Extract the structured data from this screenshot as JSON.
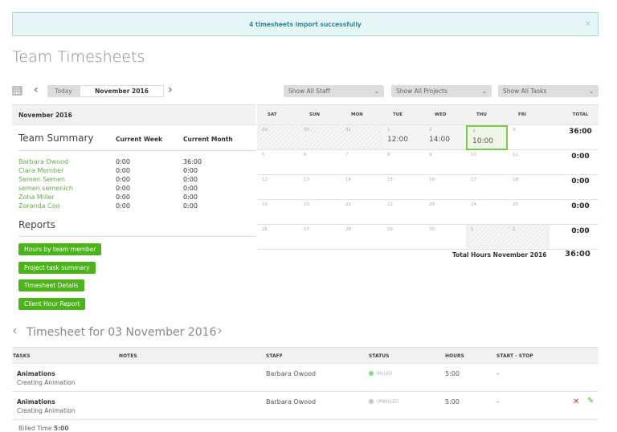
{
  "banner": {
    "message": "4 timesheets import successfully",
    "close": "×"
  },
  "page_title": "Team Timesheets",
  "toolbar": {
    "today": "Today",
    "month": "November 2016",
    "prev": "‹",
    "next": "›",
    "filters": [
      "Show All Staff",
      "Show All Projects",
      "Show All Tasks"
    ]
  },
  "summary": {
    "month_label": "November 2016",
    "title": "Team Summary",
    "col_week": "Current Week",
    "col_month": "Current Month",
    "members": [
      {
        "name": "Barbara Owood",
        "week": "0:00",
        "month": "36:00"
      },
      {
        "name": "Clara Member",
        "week": "0:00",
        "month": "0:00"
      },
      {
        "name": "Semen Semen",
        "week": "0:00",
        "month": "0:00"
      },
      {
        "name": "semen semenich",
        "week": "0:00",
        "month": "0:00"
      },
      {
        "name": "Zoha Miller",
        "week": "0:00",
        "month": "0:00"
      },
      {
        "name": "Zoranda Coo",
        "week": "0:00",
        "month": "0:00"
      }
    ]
  },
  "reports": {
    "title": "Reports",
    "buttons": [
      "Hours by team member",
      "Project task summary",
      "Timesheet Details",
      "Client Hour Report"
    ]
  },
  "calendar": {
    "days": [
      "SAT",
      "SUN",
      "MON",
      "TUE",
      "WED",
      "THU",
      "FRI"
    ],
    "total_label": "TOTAL",
    "weeks": [
      {
        "dates": [
          "29",
          "30",
          "31",
          "1",
          "2",
          "3",
          "4"
        ],
        "hours": [
          "",
          "",
          "",
          "12:00",
          "14:00",
          "10:00",
          ""
        ],
        "total": "36:00"
      },
      {
        "dates": [
          "5",
          "6",
          "7",
          "8",
          "9",
          "10",
          "11"
        ],
        "hours": [
          "",
          "",
          "",
          "",
          "",
          "",
          ""
        ],
        "total": "0:00"
      },
      {
        "dates": [
          "12",
          "13",
          "14",
          "15",
          "16",
          "17",
          "18"
        ],
        "hours": [
          "",
          "",
          "",
          "",
          "",
          "",
          ""
        ],
        "total": "0:00"
      },
      {
        "dates": [
          "19",
          "20",
          "21",
          "22",
          "23",
          "24",
          "25"
        ],
        "hours": [
          "",
          "",
          "",
          "",
          "",
          "",
          ""
        ],
        "total": "0:00"
      },
      {
        "dates": [
          "26",
          "27",
          "28",
          "29",
          "30",
          "1",
          "2"
        ],
        "hours": [
          "",
          "",
          "",
          "",
          "",
          "",
          ""
        ],
        "total": "0:00"
      }
    ],
    "month_total_label": "Total Hours November 2016",
    "month_total": "36:00"
  },
  "timesheet": {
    "title": "Timesheet for 03 November 2016",
    "headers": [
      "TASKS",
      "NOTES",
      "STAFF",
      "STATUS",
      "HOURS",
      "START - STOP"
    ],
    "rows": [
      {
        "task": "Animations",
        "subtask": "Creating Animation",
        "notes": "",
        "staff": "Barbara Owood",
        "status": "BILLED",
        "status_color": "#8fd18f",
        "hours": "5:00",
        "start_stop": "-"
      },
      {
        "task": "Animations",
        "subtask": "Creating Animation",
        "notes": "",
        "staff": "Barbara Owood",
        "status": "UNBILLED",
        "status_color": "#c8c8c8",
        "hours": "5:00",
        "start_stop": "-"
      }
    ],
    "billed_label": "Billed Time",
    "billed_value": "5:00"
  }
}
